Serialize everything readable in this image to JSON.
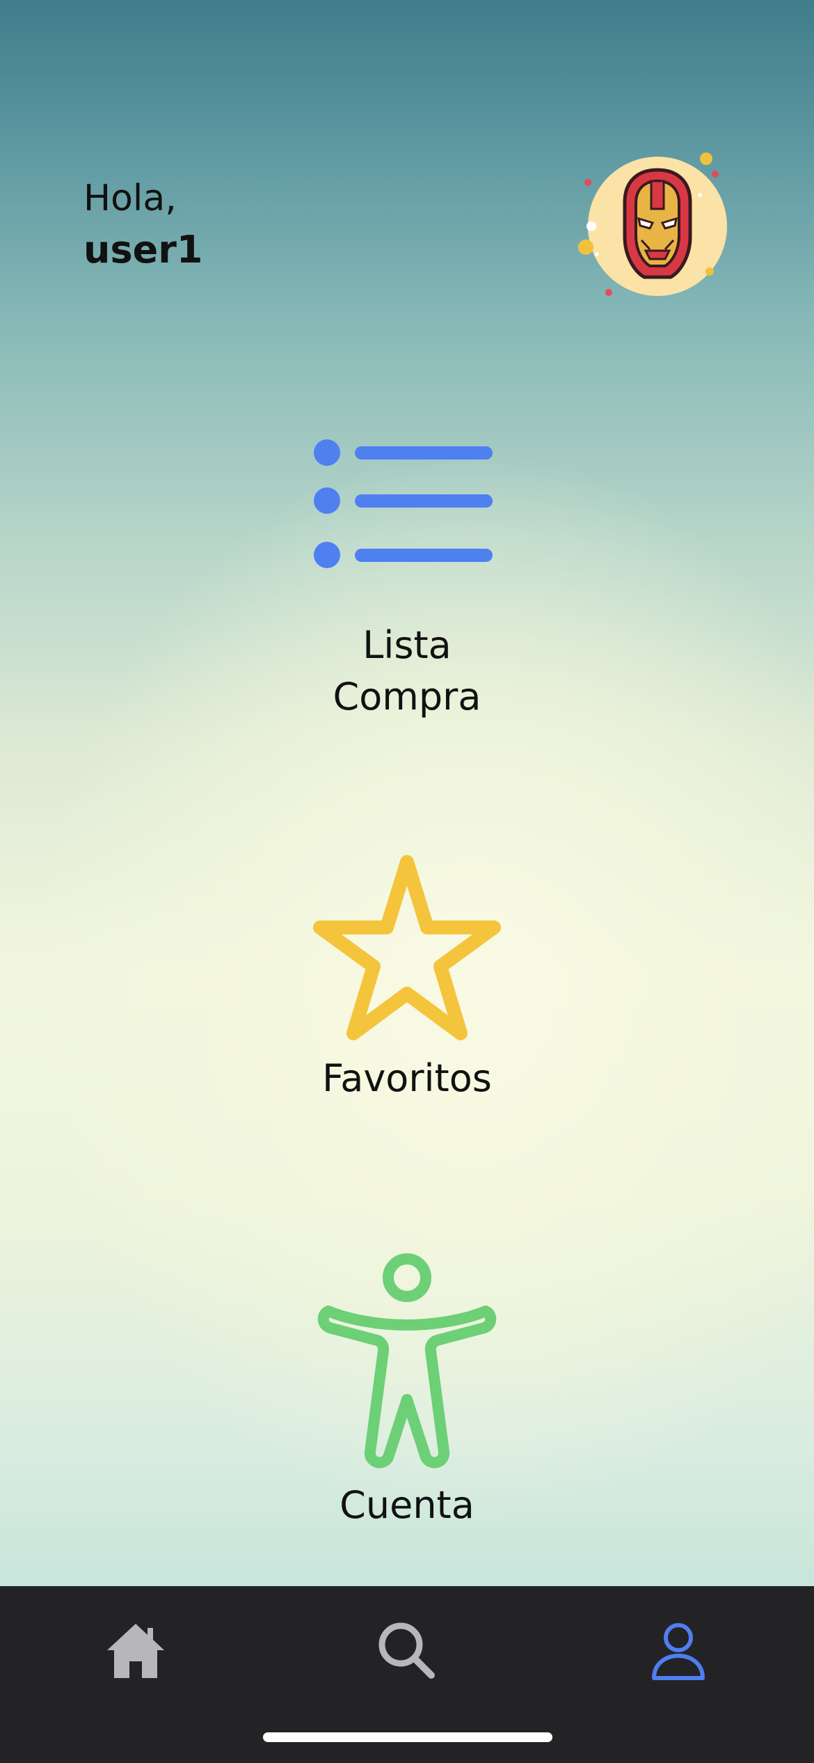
{
  "header": {
    "greeting": "Hola,",
    "username": "user1",
    "avatar_icon": "iron-man-avatar"
  },
  "menu": [
    {
      "label": "Lista\nCompra",
      "icon": "list-icon",
      "color": "#4f80f0"
    },
    {
      "label": "Favoritos",
      "icon": "star-icon",
      "color": "#f5c43d"
    },
    {
      "label": "Cuenta",
      "icon": "accessibility-person-icon",
      "color": "#6dcf76"
    }
  ],
  "tabbar": {
    "tabs": [
      {
        "name": "home",
        "icon": "home-icon",
        "active": false
      },
      {
        "name": "search",
        "icon": "search-icon",
        "active": false
      },
      {
        "name": "account",
        "icon": "person-icon",
        "active": true
      }
    ],
    "background": "#232326",
    "inactive_color": "#b7b7ba",
    "active_color": "#4f7ef0"
  }
}
